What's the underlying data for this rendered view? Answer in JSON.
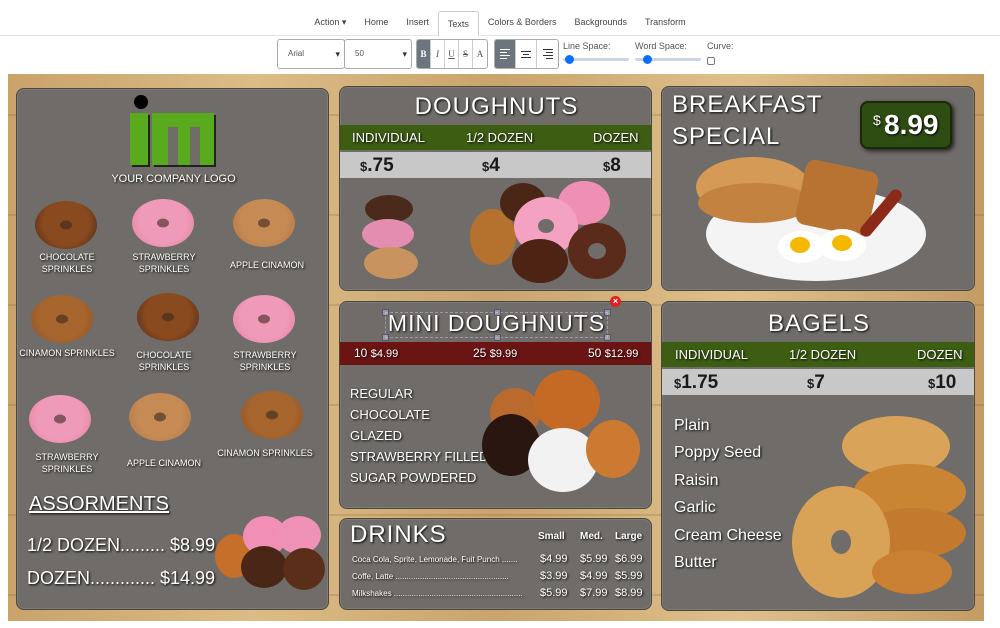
{
  "tabs": [
    {
      "label": "Action ▾"
    },
    {
      "label": "Home"
    },
    {
      "label": "Insert"
    },
    {
      "label": "Texts"
    },
    {
      "label": "Colors & Borders"
    },
    {
      "label": "Backgrounds"
    },
    {
      "label": "Transform"
    }
  ],
  "toolbar": {
    "font": "Arial",
    "size": "50",
    "bold": "B",
    "italic": "I",
    "underline": "U",
    "strike": "S",
    "clear": "A",
    "line_space": "Line Space:",
    "word_space": "Word Space:",
    "curve": "Curve:"
  },
  "logo": {
    "caption": "YOUR COMPANY LOGO"
  },
  "donut_grid": [
    {
      "label": "CHOCOLATE SPRINKLES"
    },
    {
      "label": "STRAWBERRY SPRINKLES"
    },
    {
      "label": "APPLE CINAMON"
    },
    {
      "label": "CINAMON SPRINKLES"
    },
    {
      "label": "CHOCOLATE SPRINKLES"
    },
    {
      "label": "STRAWBERRY SPRINKLES"
    },
    {
      "label": "STRAWBERRY SPRINKLES"
    },
    {
      "label": "APPLE CINAMON"
    },
    {
      "label": "CINAMON SPRINKLES"
    }
  ],
  "assortments": {
    "title": "ASSORMENTS",
    "half": "1/2 DOZEN......... $8.99",
    "dozen": "DOZEN............. $14.99"
  },
  "doughnuts": {
    "title": "DOUGHNUTS",
    "headers": [
      "INDIVIDUAL",
      "1/2 DOZEN",
      "DOZEN"
    ],
    "prices": [
      {
        "cur": "$",
        "amt": ".75"
      },
      {
        "cur": "$",
        "amt": "4"
      },
      {
        "cur": "$",
        "amt": "8"
      }
    ]
  },
  "breakfast": {
    "title1": "BREAKFAST",
    "title2": "SPECIAL",
    "cur": "$",
    "price": "8.99"
  },
  "mini": {
    "title": "MINI DOUGHNUTS",
    "prices": [
      {
        "qty": "10",
        "p": "$4.99"
      },
      {
        "qty": "25",
        "p": "$9.99"
      },
      {
        "qty": "50",
        "p": "$12.99"
      }
    ],
    "items": [
      "REGULAR",
      "CHOCOLATE",
      "GLAZED",
      "STRAWBERRY FILLED",
      "SUGAR POWDERED"
    ]
  },
  "bagels": {
    "title": "BAGELS",
    "headers": [
      "INDIVIDUAL",
      "1/2 DOZEN",
      "DOZEN"
    ],
    "prices": [
      {
        "cur": "$",
        "amt": "1.75"
      },
      {
        "cur": "$",
        "amt": "7"
      },
      {
        "cur": "$",
        "amt": "10"
      }
    ],
    "items": [
      "Plain",
      "Poppy Seed",
      "Raisin",
      "Garlic",
      "Cream Cheese",
      "Butter"
    ]
  },
  "drinks": {
    "title": "DRINKS",
    "cols": [
      "Small",
      "Med.",
      "Large"
    ],
    "rows": [
      {
        "name": "Coca Cola, Sprite, Lemonade, Fuit Punch .......",
        "s": "$4.99",
        "m": "$5.99",
        "l": "$6.99"
      },
      {
        "name": "Coffe, Latte ...................................................",
        "s": "$3.99",
        "m": "$4.99",
        "l": "$5.99"
      },
      {
        "name": "Milkshakes ..........................................................",
        "s": "$5.99",
        "m": "$7.99",
        "l": "$8.99"
      }
    ]
  },
  "colors": {
    "green_band": "#3d5d13",
    "red_band": "#6b1414",
    "logo_green": "#5aaa1e",
    "panel": "#6f6c69"
  }
}
